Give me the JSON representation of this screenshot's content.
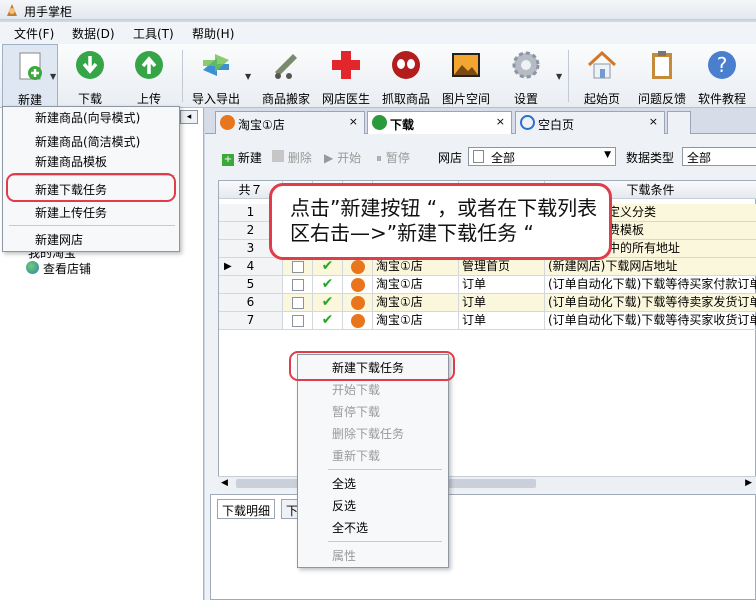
{
  "app": {
    "title": "用手掌柜"
  },
  "menu": [
    "文件(F)",
    "数据(D)",
    "工具(T)",
    "帮助(H)"
  ],
  "toolbar": {
    "items": [
      {
        "label": "新建",
        "icon": "new-document-icon"
      },
      {
        "label": "下载",
        "icon": "download-arrow-icon"
      },
      {
        "label": "上传",
        "icon": "upload-arrow-icon"
      },
      {
        "label": "导入导出",
        "icon": "import-export-icon"
      },
      {
        "label": "商品搬家",
        "icon": "moving-cart-icon"
      },
      {
        "label": "网店医生",
        "icon": "medical-cross-icon"
      },
      {
        "label": "抓取商品",
        "icon": "spider-icon"
      },
      {
        "label": "图片空间",
        "icon": "picture-icon"
      },
      {
        "label": "设置",
        "icon": "gear-icon"
      },
      {
        "label": "起始页",
        "icon": "home-icon"
      },
      {
        "label": "问题反馈",
        "icon": "clipboard-icon"
      },
      {
        "label": "软件教程",
        "icon": "help-icon"
      }
    ]
  },
  "new_menu": {
    "items": [
      "新建商品(向导模式)",
      "新建商品(简洁模式)",
      "新建商品模板",
      "新建下载任务",
      "新建上传任务",
      "新建网店"
    ]
  },
  "tree": {
    "items": [
      "我的淘宝",
      "查看店铺"
    ]
  },
  "tabs": [
    {
      "label": "淘宝①店",
      "close": "×"
    },
    {
      "label": "下载",
      "close": "×"
    },
    {
      "label": "空白页",
      "close": "×"
    }
  ],
  "subtoolbar": {
    "new": "新建",
    "delete": "删除",
    "start": "开始",
    "pause": "暂停",
    "shop_label": "网店",
    "shop_value": "全部",
    "type_label": "数据类型",
    "type_value": "全部"
  },
  "grid": {
    "count_label": "共７",
    "condition_header": "下载条件",
    "rows": [
      {
        "n": "1",
        "shop": "",
        "type": "",
        "cond": "下载所有自定义分类"
      },
      {
        "n": "2",
        "shop": "",
        "type": "",
        "cond": "下载所有运费模板"
      },
      {
        "n": "3",
        "shop": "",
        "type": "",
        "cond": "下载地址库中的所有地址"
      },
      {
        "n": "4",
        "shop": "淘宝①店",
        "type": "管理首页",
        "cond": "(新建网店)下载网店地址"
      },
      {
        "n": "5",
        "shop": "淘宝①店",
        "type": "订单",
        "cond": "(订单自动化下载)下载等待买家付款订单"
      },
      {
        "n": "6",
        "shop": "淘宝①店",
        "type": "订单",
        "cond": "(订单自动化下载)下载等待卖家发货订单"
      },
      {
        "n": "7",
        "shop": "淘宝①店",
        "type": "订单",
        "cond": "(订单自动化下载)下载等待买家收货订单"
      }
    ]
  },
  "callout": {
    "text": "点击”新建按钮 “，或者在下载列表区右击—>”新建下载任务 “"
  },
  "context_menu": {
    "items": [
      "新建下载任务",
      "开始下载",
      "暂停下载",
      "删除下载任务",
      "重新下载",
      "全选",
      "反选",
      "全不选",
      "属性"
    ]
  },
  "bottom_tabs": [
    "下载明细",
    "下"
  ]
}
